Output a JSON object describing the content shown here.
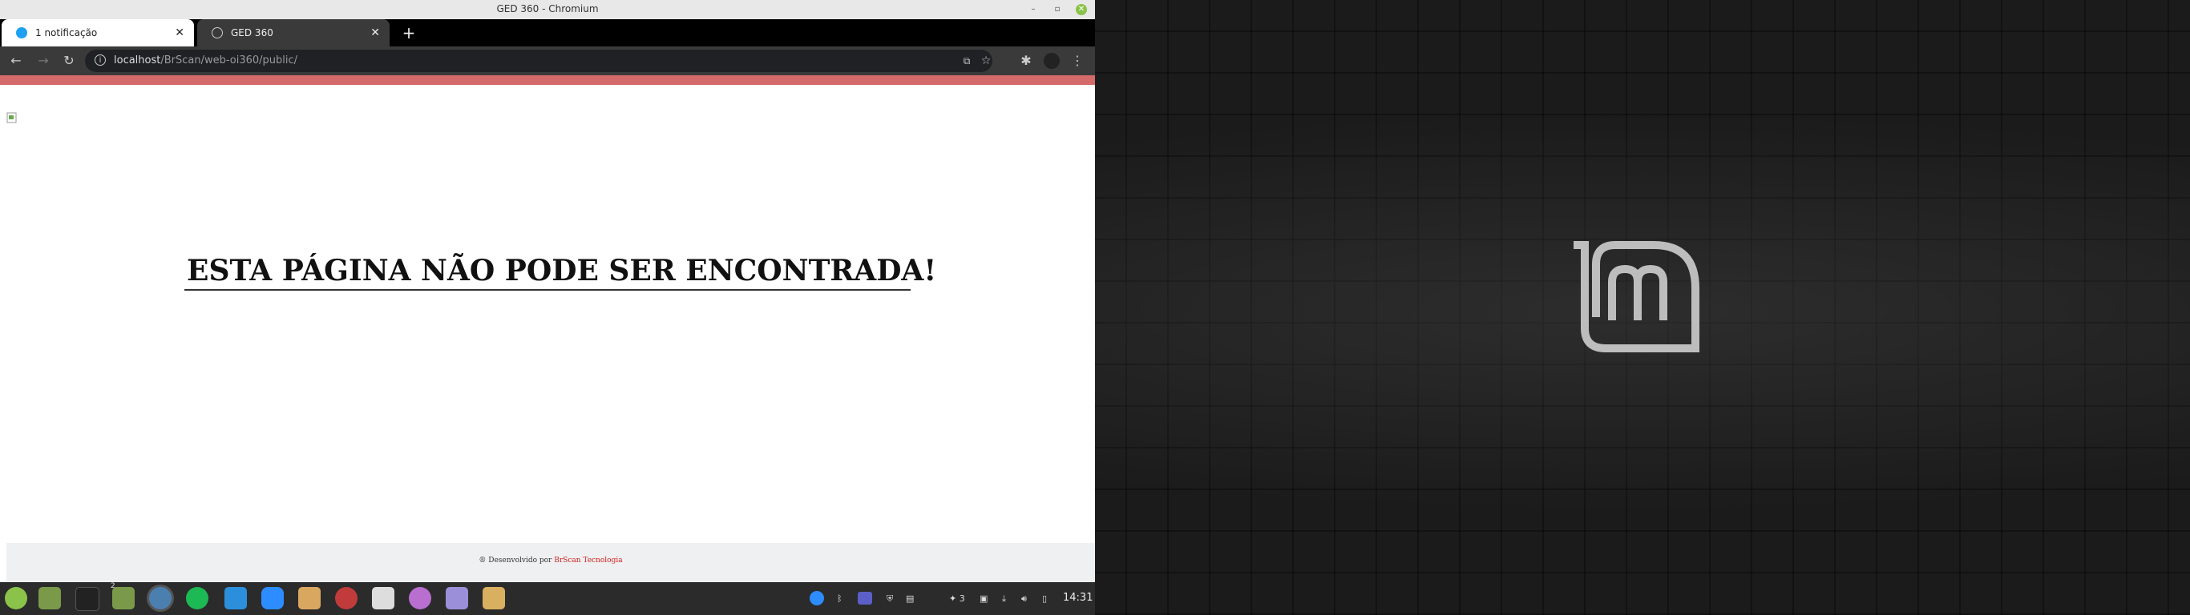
{
  "window": {
    "title": "GED 360 - Chromium"
  },
  "tabs": [
    {
      "label": "1 notificação",
      "favicon": "chat-bubble-icon",
      "color": "#1ea1f2"
    },
    {
      "label": "GED 360",
      "favicon": "globe-icon"
    }
  ],
  "omnibox": {
    "host": "localhost",
    "path": "/BrScan/web-oi360/public/"
  },
  "page": {
    "accent_color": "#d46a6a",
    "heading": "ESTA PÁGINA NÃO PODE SER ENCONTRADA!",
    "footer_prefix": "® Desenvolvido por ",
    "footer_link": "BrScan Tecnologia"
  },
  "taskbar": {
    "apps": [
      "linux-mint-menu-icon",
      "files-icon",
      "terminal-icon",
      "folder-icon",
      "chromium-icon",
      "spotify-icon",
      "vscode-icon",
      "zoom-icon",
      "archive-icon",
      "glasses-icon",
      "settings-icon",
      "shuffle-icon",
      "text-editor-icon",
      "package-icon"
    ],
    "workspace_badge": "2",
    "tray_count": "3",
    "clock": "14:31"
  }
}
